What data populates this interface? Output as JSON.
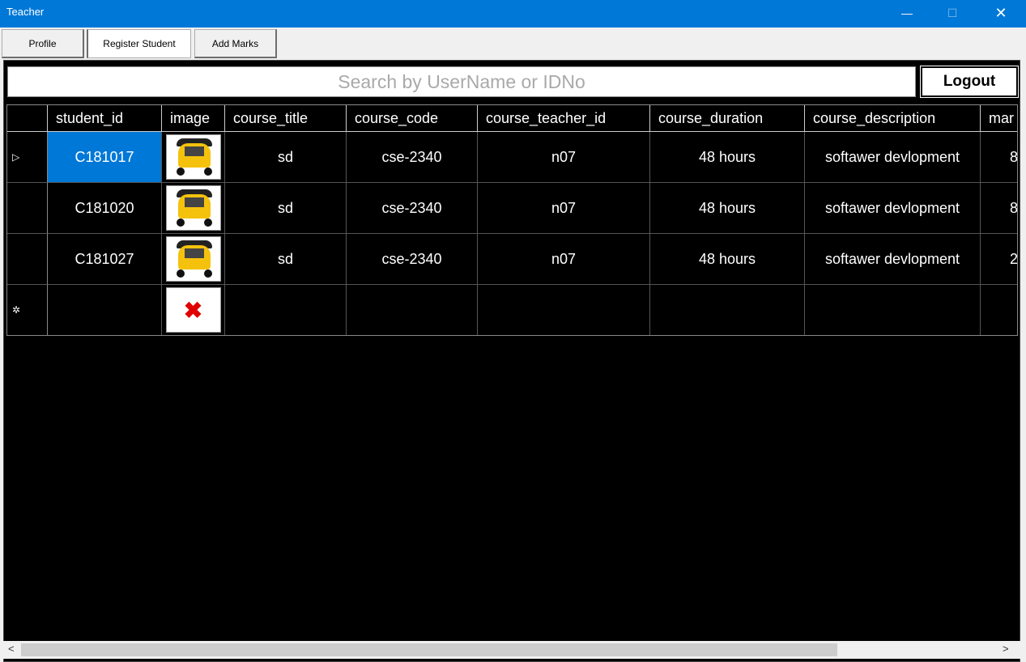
{
  "window": {
    "title": "Teacher",
    "minimize_icon": "minimize-icon",
    "maximize_icon": "maximize-icon",
    "close_icon": "close-icon"
  },
  "tabs": [
    {
      "label": "Profile"
    },
    {
      "label": "Register Student"
    },
    {
      "label": "Add Marks"
    }
  ],
  "search": {
    "placeholder": "Search by UserName or IDNo"
  },
  "logout_label": "Logout",
  "grid": {
    "columns": [
      "student_id",
      "image",
      "course_title",
      "course_code",
      "course_teacher_id",
      "course_duration",
      "course_description",
      "mar"
    ],
    "rows": [
      {
        "student_id": "C181017",
        "course_title": "sd",
        "course_code": "cse-2340",
        "course_teacher_id": "n07",
        "course_duration": "48 hours",
        "course_description": "softawer devlopment",
        "mar": "8"
      },
      {
        "student_id": "C181020",
        "course_title": "sd",
        "course_code": "cse-2340",
        "course_teacher_id": "n07",
        "course_duration": "48 hours",
        "course_description": "softawer devlopment",
        "mar": "8"
      },
      {
        "student_id": "C181027",
        "course_title": "sd",
        "course_code": "cse-2340",
        "course_teacher_id": "n07",
        "course_duration": "48 hours",
        "course_description": "softawer devlopment",
        "mar": "2"
      }
    ],
    "current_row_marker": "▷",
    "new_row_marker": "✲",
    "broken_image_glyph": "✖"
  },
  "scrollbar": {
    "left_arrow": "<",
    "right_arrow": ">"
  },
  "colors": {
    "titlebar": "#0078d7",
    "selection": "#0078d7",
    "grid_background": "#000000"
  }
}
